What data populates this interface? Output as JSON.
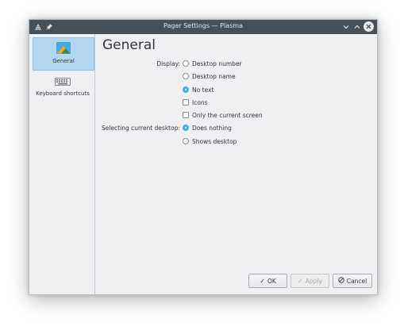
{
  "window": {
    "title": "Pager Settings — Plasma"
  },
  "titlebar_icons": {
    "app_icon": "plasma-pager-icon",
    "pin_icon": "pin-icon",
    "minimize_icon": "chevron-down-icon",
    "maximize_icon": "chevron-up-icon",
    "close_icon": "close-icon"
  },
  "sidebar": {
    "items": [
      {
        "label": "General",
        "icon": "general-pager-icon",
        "selected": true
      },
      {
        "label": "Keyboard shortcuts",
        "icon": "keyboard-icon",
        "selected": false
      }
    ]
  },
  "page": {
    "title": "General"
  },
  "display": {
    "label": "Display:",
    "options": [
      {
        "label": "Desktop number",
        "type": "radio",
        "checked": false
      },
      {
        "label": "Desktop name",
        "type": "radio",
        "checked": false
      },
      {
        "label": "No text",
        "type": "radio",
        "checked": true
      },
      {
        "label": "Icons",
        "type": "checkbox",
        "checked": false
      },
      {
        "label": "Only the current screen",
        "type": "checkbox",
        "checked": false
      }
    ]
  },
  "selecting": {
    "label": "Selecting current desktop:",
    "options": [
      {
        "label": "Does nothing",
        "type": "radio",
        "checked": true
      },
      {
        "label": "Shows desktop",
        "type": "radio",
        "checked": false
      }
    ]
  },
  "buttons": {
    "ok": "OK",
    "apply": "Apply",
    "cancel": "Cancel"
  },
  "colors": {
    "accent": "#3daee9",
    "titlebar": "#475057",
    "selection": "#b4d7f1"
  }
}
